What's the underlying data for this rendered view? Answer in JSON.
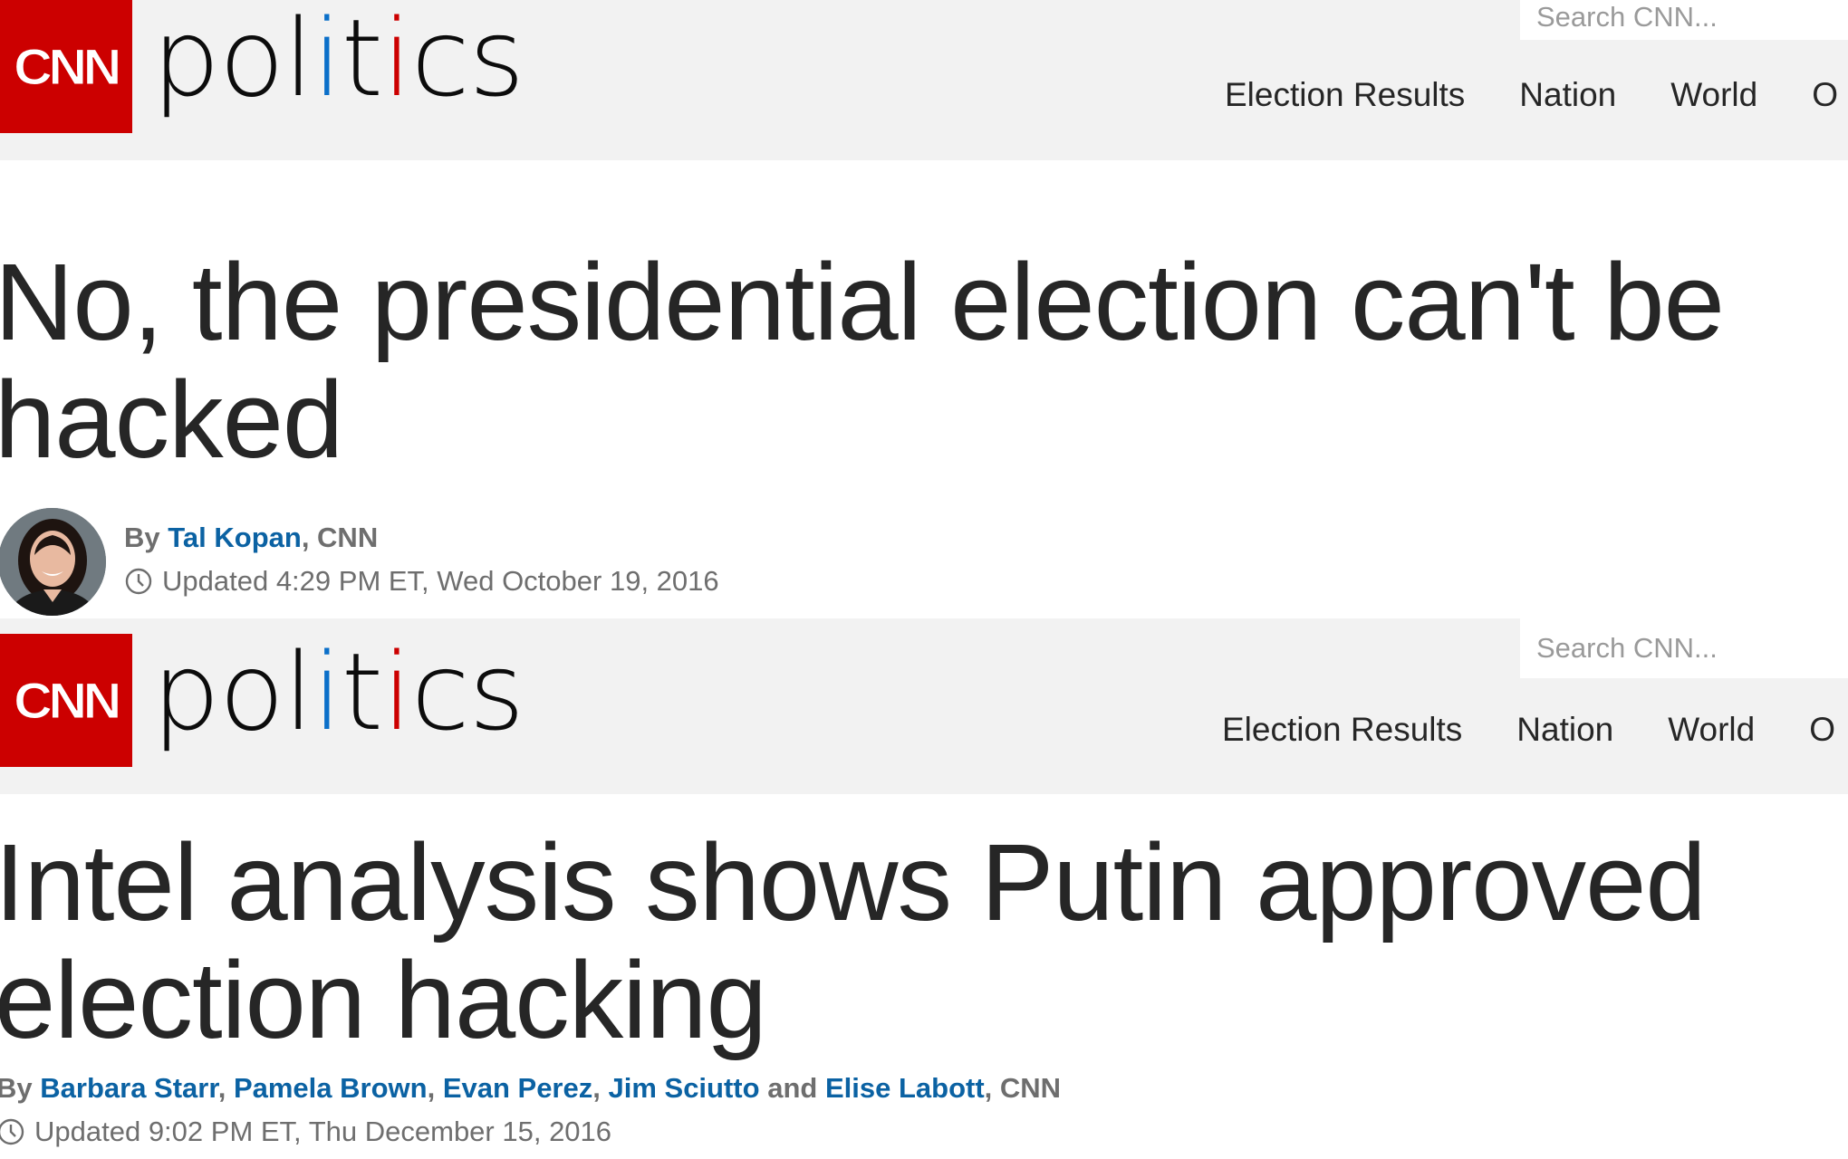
{
  "brand": {
    "logo_text": "CNN",
    "section": "politics",
    "accent_color": "#cc0000",
    "link_color": "#0b62a3"
  },
  "articles": [
    {
      "search_placeholder": "Search CNN...",
      "nav": [
        "Election Results",
        "Nation",
        "World",
        "O"
      ],
      "headline_line1": "No, the presidential election can't be",
      "headline_line2": "hacked",
      "byline_prefix": "By",
      "authors": [
        "Tal Kopan"
      ],
      "source": "CNN",
      "updated": "Updated 4:29 PM ET, Wed October 19, 2016"
    },
    {
      "search_placeholder": "Search CNN...",
      "nav": [
        "Election Results",
        "Nation",
        "World",
        "O"
      ],
      "headline_line1": "Intel analysis shows Putin approved",
      "headline_line2": "election hacking",
      "byline_prefix": "By",
      "authors": [
        "Barbara Starr",
        "Pamela Brown",
        "Evan Perez",
        "Jim Sciutto",
        "Elise Labott"
      ],
      "conjunction": "and",
      "source": "CNN",
      "updated": "Updated 9:02 PM ET, Thu December 15, 2016"
    }
  ]
}
